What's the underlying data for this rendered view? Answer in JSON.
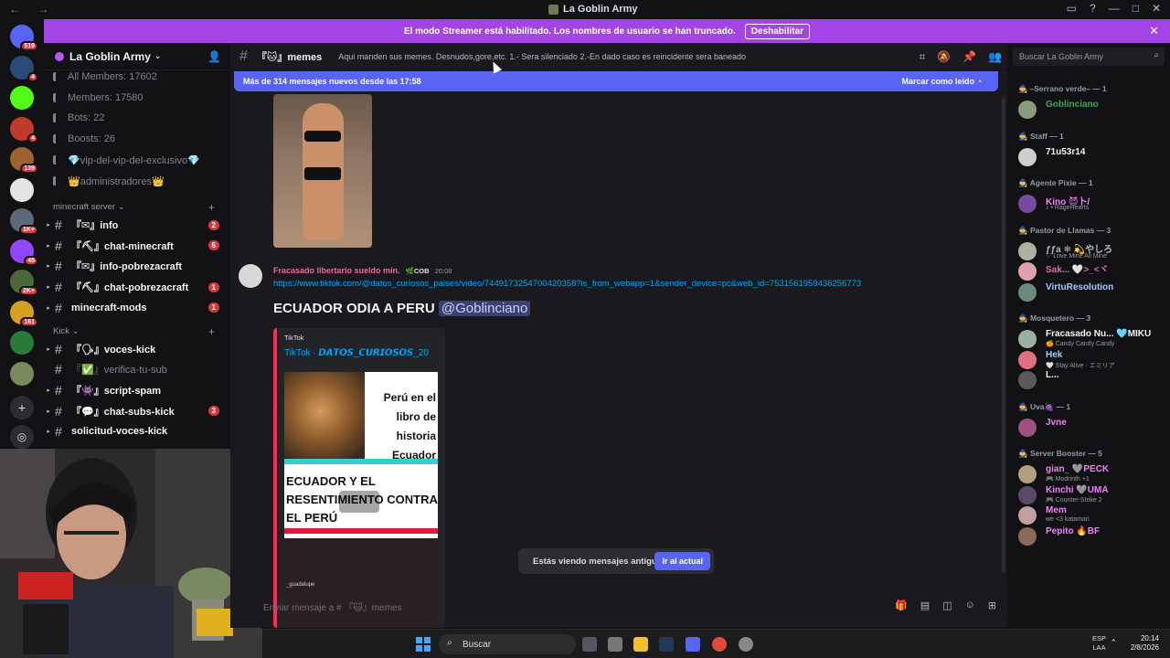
{
  "titlebar": {
    "title": "La Goblin Army",
    "nav": "← →"
  },
  "banner": {
    "text": "El modo Streamer está habilitado. Los nombres de usuario se han truncado.",
    "button": "Deshabilitar"
  },
  "guilds": [
    {
      "badge": "519",
      "color": "#5865f2"
    },
    {
      "badge": "4",
      "color": "#2a4a7a"
    },
    {
      "badge": "",
      "color": "#53fc18"
    },
    {
      "badge": "4",
      "color": "#c0392b"
    },
    {
      "badge": "139",
      "color": "#a0622d"
    },
    {
      "badge": "",
      "color": "#e3e3e3"
    },
    {
      "badge": "1K+",
      "color": "#5a6a7a"
    },
    {
      "badge": "45",
      "color": "#9146ff"
    },
    {
      "badge": "2K+",
      "color": "#4a6a3a"
    },
    {
      "badge": "161",
      "color": "#d4a020"
    },
    {
      "badge": "",
      "color": "#2a7a3a"
    },
    {
      "badge": "",
      "color": "#7a8a5a"
    }
  ],
  "server": {
    "name": "La Goblin Army",
    "stats": [
      "All Members: 17602",
      "Members: 17580",
      "Bots: 22",
      "Boosts: 26",
      "💎vip-del-vip-del-exclusivo💎",
      "👑administradores👑"
    ],
    "categories": [
      {
        "name": "minecraft server",
        "channels": [
          {
            "name": "『✉』info",
            "count": "2",
            "muted": false
          },
          {
            "name": "『⛏』chat-minecraft",
            "count": "6",
            "muted": false
          },
          {
            "name": "『✉』info-pobrezacraft",
            "count": "",
            "muted": false
          },
          {
            "name": "『⛏』chat-pobrezacraft",
            "count": "1",
            "muted": false
          },
          {
            "name": "minecraft-mods",
            "count": "1",
            "muted": false
          }
        ]
      },
      {
        "name": "Kick",
        "channels": [
          {
            "name": "『🗣』voces-kick",
            "count": "",
            "muted": false
          },
          {
            "name": "『✅』verifica-tu-sub",
            "count": "",
            "muted": true
          },
          {
            "name": "『👾』script-spam",
            "count": "",
            "muted": false
          },
          {
            "name": "『💬』chat-subs-kick",
            "count": "3",
            "muted": false
          },
          {
            "name": "solicitud-voces-kick",
            "count": "",
            "muted": false
          }
        ]
      }
    ]
  },
  "chat": {
    "channel": "『🐱』memes",
    "topic": "Aqui manden sus memes. Desnudos,gore,etc. 1.- Sera silenciado 2.-En dado caso es reincidente sera baneado",
    "new_messages": "Más de 314 mensajes nuevos desde las 17:58",
    "mark_read": "Marcar como leído",
    "message": {
      "author": "Fracasado libertario sueldo mín.",
      "tag": "🌿COB",
      "time": "20:08",
      "link": "https://www.tiktok.com/@datos_curiosos_paises/video/7449173254700420358?is_from_webapp=1&sender_device=pc&web_id=7531561959436256773",
      "title": "ECUADOR ODIA A PERU",
      "mention": "@Goblinciano",
      "embed": {
        "provider": "TikTok",
        "author": "TikTok · 𝘿𝘼𝙏𝙊𝙎_𝘾𝙐𝙍𝙄𝙊𝙎𝙊𝙎_20",
        "thumb_top": "Perú en el libro de historia Ecuador",
        "thumb_bottom": "ECUADOR Y EL RESENTIMIENTO CONTRA EL PERÚ",
        "thumb_small": "_guadalupe"
      }
    },
    "old_notice": "Estás viendo mensajes antiguos",
    "jump": "Ir al actual",
    "composer_placeholder": "Enviar mensaje a # 『🐱』memes"
  },
  "members": {
    "search_placeholder": "Buscar La Goblin Army",
    "groups": [
      {
        "label": "🧙 ⎯Serrano verde⎯ — 1",
        "members": [
          {
            "name": "Goblinciano",
            "status": "",
            "color": "#3ba55c",
            "av": "#8a9a7a"
          }
        ]
      },
      {
        "label": "🧙 Staff — 1",
        "members": [
          {
            "name": "71u53r14",
            "status": "",
            "color": "#f2f3f5",
            "av": "#cfcfcf"
          }
        ]
      },
      {
        "label": "🧙 Agente Pixie — 1",
        "members": [
          {
            "name": "Kino 😈卜/",
            "status": "♪ • RageHearts",
            "color": "#f47fff",
            "av": "#7a4aa0"
          }
        ]
      },
      {
        "label": "🧙 Pastor de Llamas — 3",
        "members": [
          {
            "name": "ƒƒa ❄ 💫やしろ",
            "status": "♡ Love Mine All Mine",
            "color": "#b5bac1",
            "av": "#b0b0a0"
          },
          {
            "name": "Sak... 🤍>_<ヾ",
            "status": "",
            "color": "#e36ba6",
            "av": "#e0a0b0"
          },
          {
            "name": "VirtuResolution",
            "status": "",
            "color": "#a8c8ff",
            "av": "#6a8a7a"
          }
        ]
      },
      {
        "label": "🧙 Mosquetero — 3",
        "members": [
          {
            "name": "Fracasado Nu... 🩵MIKU",
            "status": "🍊 Candy Candy Candy",
            "color": "#f2f3f5",
            "av": "#9ab0a0"
          },
          {
            "name": "Hek",
            "status": "🤍 Stay Alive · エミリア",
            "color": "#9ad0ff",
            "av": "#e07080"
          },
          {
            "name": "L...",
            "status": "",
            "color": "#f2f3f5",
            "av": "#5a5a5a"
          }
        ]
      },
      {
        "label": "🧙 Uva🍇 — 1",
        "members": [
          {
            "name": "Jvne",
            "status": "",
            "color": "#f47fff",
            "av": "#a05080"
          }
        ]
      },
      {
        "label": "🧙 Server Booster — 5",
        "members": [
          {
            "name": "gian_ 🩶PECK",
            "status": "🎮 Modrinth +1",
            "color": "#f47fff",
            "av": "#b0a080"
          },
          {
            "name": "Kinchi 🩶UMA",
            "status": "🎮 Counter-Strike 2",
            "color": "#f47fff",
            "av": "#5a4a6a"
          },
          {
            "name": "Mem",
            "status": "we <3 katamari",
            "color": "#f47fff",
            "av": "#c0a0a0"
          },
          {
            "name": "Pepito 🔥BF",
            "status": "",
            "color": "#f47fff",
            "av": "#8a6a5a"
          }
        ]
      }
    ]
  },
  "taskbar": {
    "search": "Buscar",
    "lang1": "ESP",
    "lang2": "LAA",
    "time": "20:14",
    "date": "2/8/2026"
  }
}
